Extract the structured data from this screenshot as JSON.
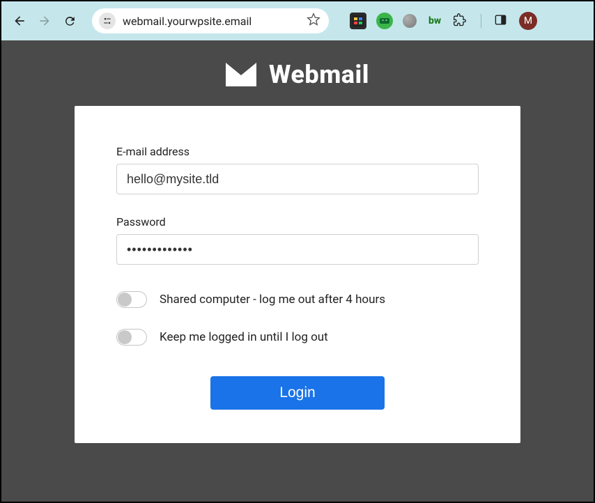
{
  "browser": {
    "url": "webmail.yourwpsite.email",
    "avatar_initial": "M",
    "ext_bw": "bw"
  },
  "brand": {
    "title": "Webmail"
  },
  "form": {
    "email_label": "E-mail address",
    "email_value": "hello@mysite.tld",
    "password_label": "Password",
    "password_value": "•••••••••••••",
    "toggle_shared": "Shared computer - log me out after 4 hours",
    "toggle_keep": "Keep me logged in until I log out",
    "login_button": "Login"
  }
}
